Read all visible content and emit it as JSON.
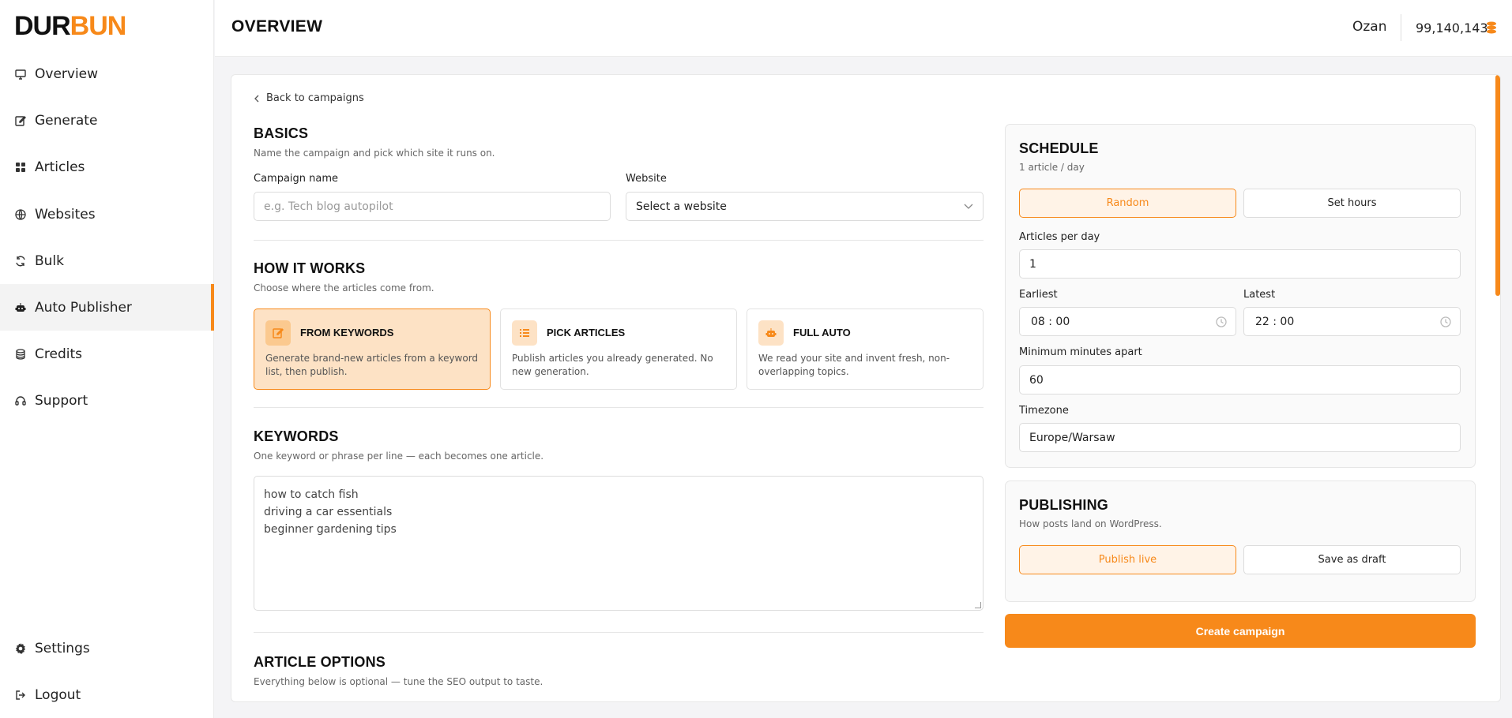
{
  "brand": {
    "part1": "DUR",
    "part2": "BUN"
  },
  "sidebar": {
    "items": [
      {
        "label": "Overview",
        "icon": "monitor-icon"
      },
      {
        "label": "Generate",
        "icon": "edit-icon"
      },
      {
        "label": "Articles",
        "icon": "grid-icon"
      },
      {
        "label": "Websites",
        "icon": "globe-icon"
      },
      {
        "label": "Bulk",
        "icon": "refresh-icon"
      },
      {
        "label": "Auto Publisher",
        "icon": "robot-icon",
        "active": true
      },
      {
        "label": "Credits",
        "icon": "coins-icon"
      },
      {
        "label": "Support",
        "icon": "headset-icon"
      }
    ],
    "bottom": [
      {
        "label": "Settings",
        "icon": "gear-icon"
      },
      {
        "label": "Logout",
        "icon": "logout-icon"
      }
    ]
  },
  "header": {
    "title": "OVERVIEW",
    "user": "Ozan",
    "credits": "99,140,143"
  },
  "main": {
    "back": "Back to campaigns",
    "basics": {
      "title": "BASICS",
      "subtitle": "Name the campaign and pick which site it runs on.",
      "name_label": "Campaign name",
      "name_placeholder": "e.g. Tech blog autopilot",
      "website_label": "Website",
      "website_value": "Select a website"
    },
    "how": {
      "title": "HOW IT WORKS",
      "subtitle": "Choose where the articles come from.",
      "modes": [
        {
          "title": "FROM KEYWORDS",
          "desc": "Generate brand-new articles from a keyword list, then publish.",
          "active": true
        },
        {
          "title": "PICK ARTICLES",
          "desc": "Publish articles you already generated. No new generation."
        },
        {
          "title": "FULL AUTO",
          "desc": "We read your site and invent fresh, non-overlapping topics."
        }
      ]
    },
    "keywords": {
      "title": "KEYWORDS",
      "subtitle": "One keyword or phrase per line — each becomes one article.",
      "lines": [
        "how to catch fish",
        "driving a car essentials",
        "beginner gardening tips"
      ]
    },
    "options": {
      "title": "ARTICLE OPTIONS",
      "subtitle": "Everything below is optional — tune the SEO output to taste."
    }
  },
  "schedule": {
    "title": "SCHEDULE",
    "subtitle": "1 article / day",
    "mode_random": "Random",
    "mode_hours": "Set hours",
    "per_day_label": "Articles per day",
    "per_day_value": "1",
    "earliest_label": "Earliest",
    "earliest_value": "08 : 00",
    "latest_label": "Latest",
    "latest_value": "22 : 00",
    "min_label": "Minimum minutes apart",
    "min_value": "60",
    "tz_label": "Timezone",
    "tz_value": "Europe/Warsaw"
  },
  "publishing": {
    "title": "PUBLISHING",
    "subtitle": "How posts land on WordPress.",
    "live": "Publish live",
    "draft": "Save as draft"
  },
  "create_label": "Create campaign",
  "colors": {
    "accent": "#f7891a",
    "accent_light": "#fde2c5"
  }
}
